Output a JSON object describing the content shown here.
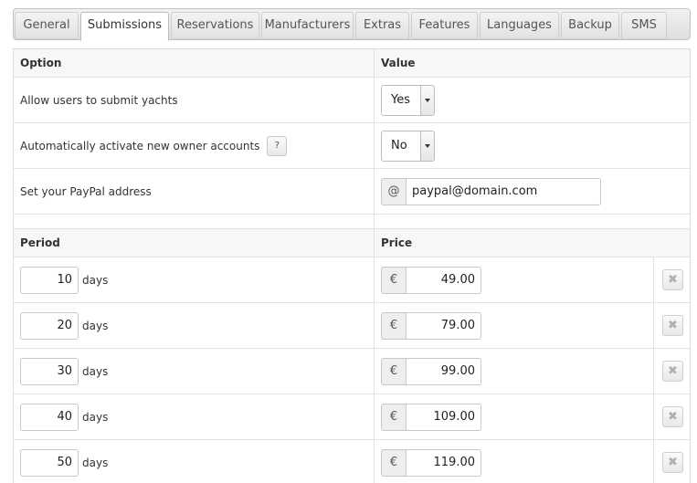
{
  "tabs": [
    {
      "label": "General"
    },
    {
      "label": "Submissions"
    },
    {
      "label": "Reservations"
    },
    {
      "label": "Manufacturers"
    },
    {
      "label": "Extras"
    },
    {
      "label": "Features"
    },
    {
      "label": "Languages"
    },
    {
      "label": "Backup"
    },
    {
      "label": "SMS"
    }
  ],
  "active_tab": "Submissions",
  "options_table": {
    "header_option": "Option",
    "header_value": "Value",
    "rows": [
      {
        "label": "Allow users to submit yachts",
        "value": "Yes"
      },
      {
        "label": "Automatically activate new owner accounts",
        "value": "No",
        "help": "?"
      },
      {
        "label": "Set your PayPal address",
        "addon": "@",
        "value": "paypal@domain.com"
      }
    ]
  },
  "pricing_table": {
    "header_period": "Period",
    "header_price": "Price",
    "unit_label": "days",
    "currency_symbol": "€",
    "delete_symbol": "✖",
    "rows": [
      {
        "period": "10",
        "price": "49.00"
      },
      {
        "period": "20",
        "price": "79.00"
      },
      {
        "period": "30",
        "price": "99.00"
      },
      {
        "period": "40",
        "price": "109.00"
      },
      {
        "period": "50",
        "price": "119.00"
      }
    ]
  }
}
